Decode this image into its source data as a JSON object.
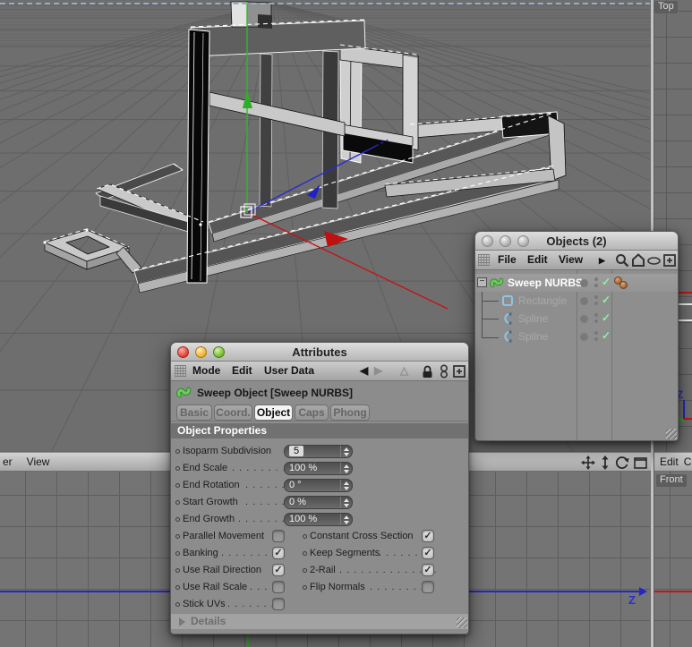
{
  "viewports": {
    "top": {
      "label": "Top",
      "z_label": "Z"
    },
    "front": {
      "label": "Front"
    },
    "side": {
      "z_label": "Z"
    },
    "side_menu": {
      "clipped_item": "er",
      "view_item": "View"
    },
    "front_menu": {
      "edit_item": "Edit",
      "clipped_item": "C"
    }
  },
  "objects_window": {
    "title": "Objects (2)",
    "menu": {
      "file": "File",
      "edit": "Edit",
      "view": "View",
      "more_arrow": "▶"
    },
    "tree": [
      {
        "label": "Sweep NURBS",
        "selected": true,
        "check": "✓",
        "tags": 2
      },
      {
        "label": "Rectangle",
        "selected": false,
        "check": "✓"
      },
      {
        "label": "Spline",
        "selected": false,
        "check": "✓"
      },
      {
        "label": "Spline",
        "selected": false,
        "check": "✓"
      }
    ],
    "expand_glyph": "−"
  },
  "attributes_window": {
    "title": "Attributes",
    "menu": {
      "mode": "Mode",
      "edit": "Edit",
      "user_data": "User Data",
      "back_arrow": "◀",
      "fwd_arrow": "▶",
      "up_arrow": "△"
    },
    "object_header": "Sweep Object [Sweep NURBS]",
    "tabs": [
      {
        "label": "Basic",
        "active": false
      },
      {
        "label": "Coord.",
        "active": false
      },
      {
        "label": "Object",
        "active": true
      },
      {
        "label": "Caps",
        "active": false
      },
      {
        "label": "Phong",
        "active": false
      }
    ],
    "section_title": "Object Properties",
    "fields": [
      {
        "label": "Isoparm Subdivision",
        "dots": "",
        "value": "5",
        "selected": true
      },
      {
        "label": "End Scale",
        "dots": ". . . . . . . . .",
        "value": "100 %",
        "selected": false
      },
      {
        "label": "End Rotation",
        "dots": ". . . . . .",
        "value": "0 °",
        "selected": false
      },
      {
        "label": "Start Growth",
        "dots": ". . . . . .",
        "value": "0 %",
        "selected": false
      },
      {
        "label": "End Growth",
        "dots": ". . . . . . . .",
        "value": "100 %",
        "selected": false
      }
    ],
    "checks": [
      {
        "label": "Parallel Movement",
        "dots": "",
        "checked": false
      },
      {
        "label": "Constant Cross Section",
        "dots": "",
        "checked": true
      },
      {
        "label": "Banking",
        "dots": ". . . . . . . . .",
        "checked": true
      },
      {
        "label": "Keep Segments",
        "dots": ". . . . . . .",
        "checked": true
      },
      {
        "label": "Use Rail Direction",
        "dots": "",
        "checked": true
      },
      {
        "label": "2-Rail",
        "dots": ". . . . . . . . . . . . . .",
        "checked": true
      },
      {
        "label": "Use Rail Scale",
        "dots": ". . . .",
        "checked": false
      },
      {
        "label": "Flip Normals",
        "dots": ". . . . . . . . .",
        "checked": false
      },
      {
        "label": "Stick UVs",
        "dots": ". . . . . . . .",
        "checked": false
      }
    ],
    "details_label": "Details",
    "check_glyph": "✓"
  },
  "colors": {
    "axis_x_red": "#c41414",
    "axis_y_green": "#35b52f",
    "axis_z_blue": "#2b2bd0",
    "horizon_blue": "#93aecd",
    "tree_check_green": "#8df0a8",
    "tag_orange": "#b5742e",
    "sweep_icon_green": "#55bb44",
    "spline_icon_blue": "#8fc3e8"
  }
}
